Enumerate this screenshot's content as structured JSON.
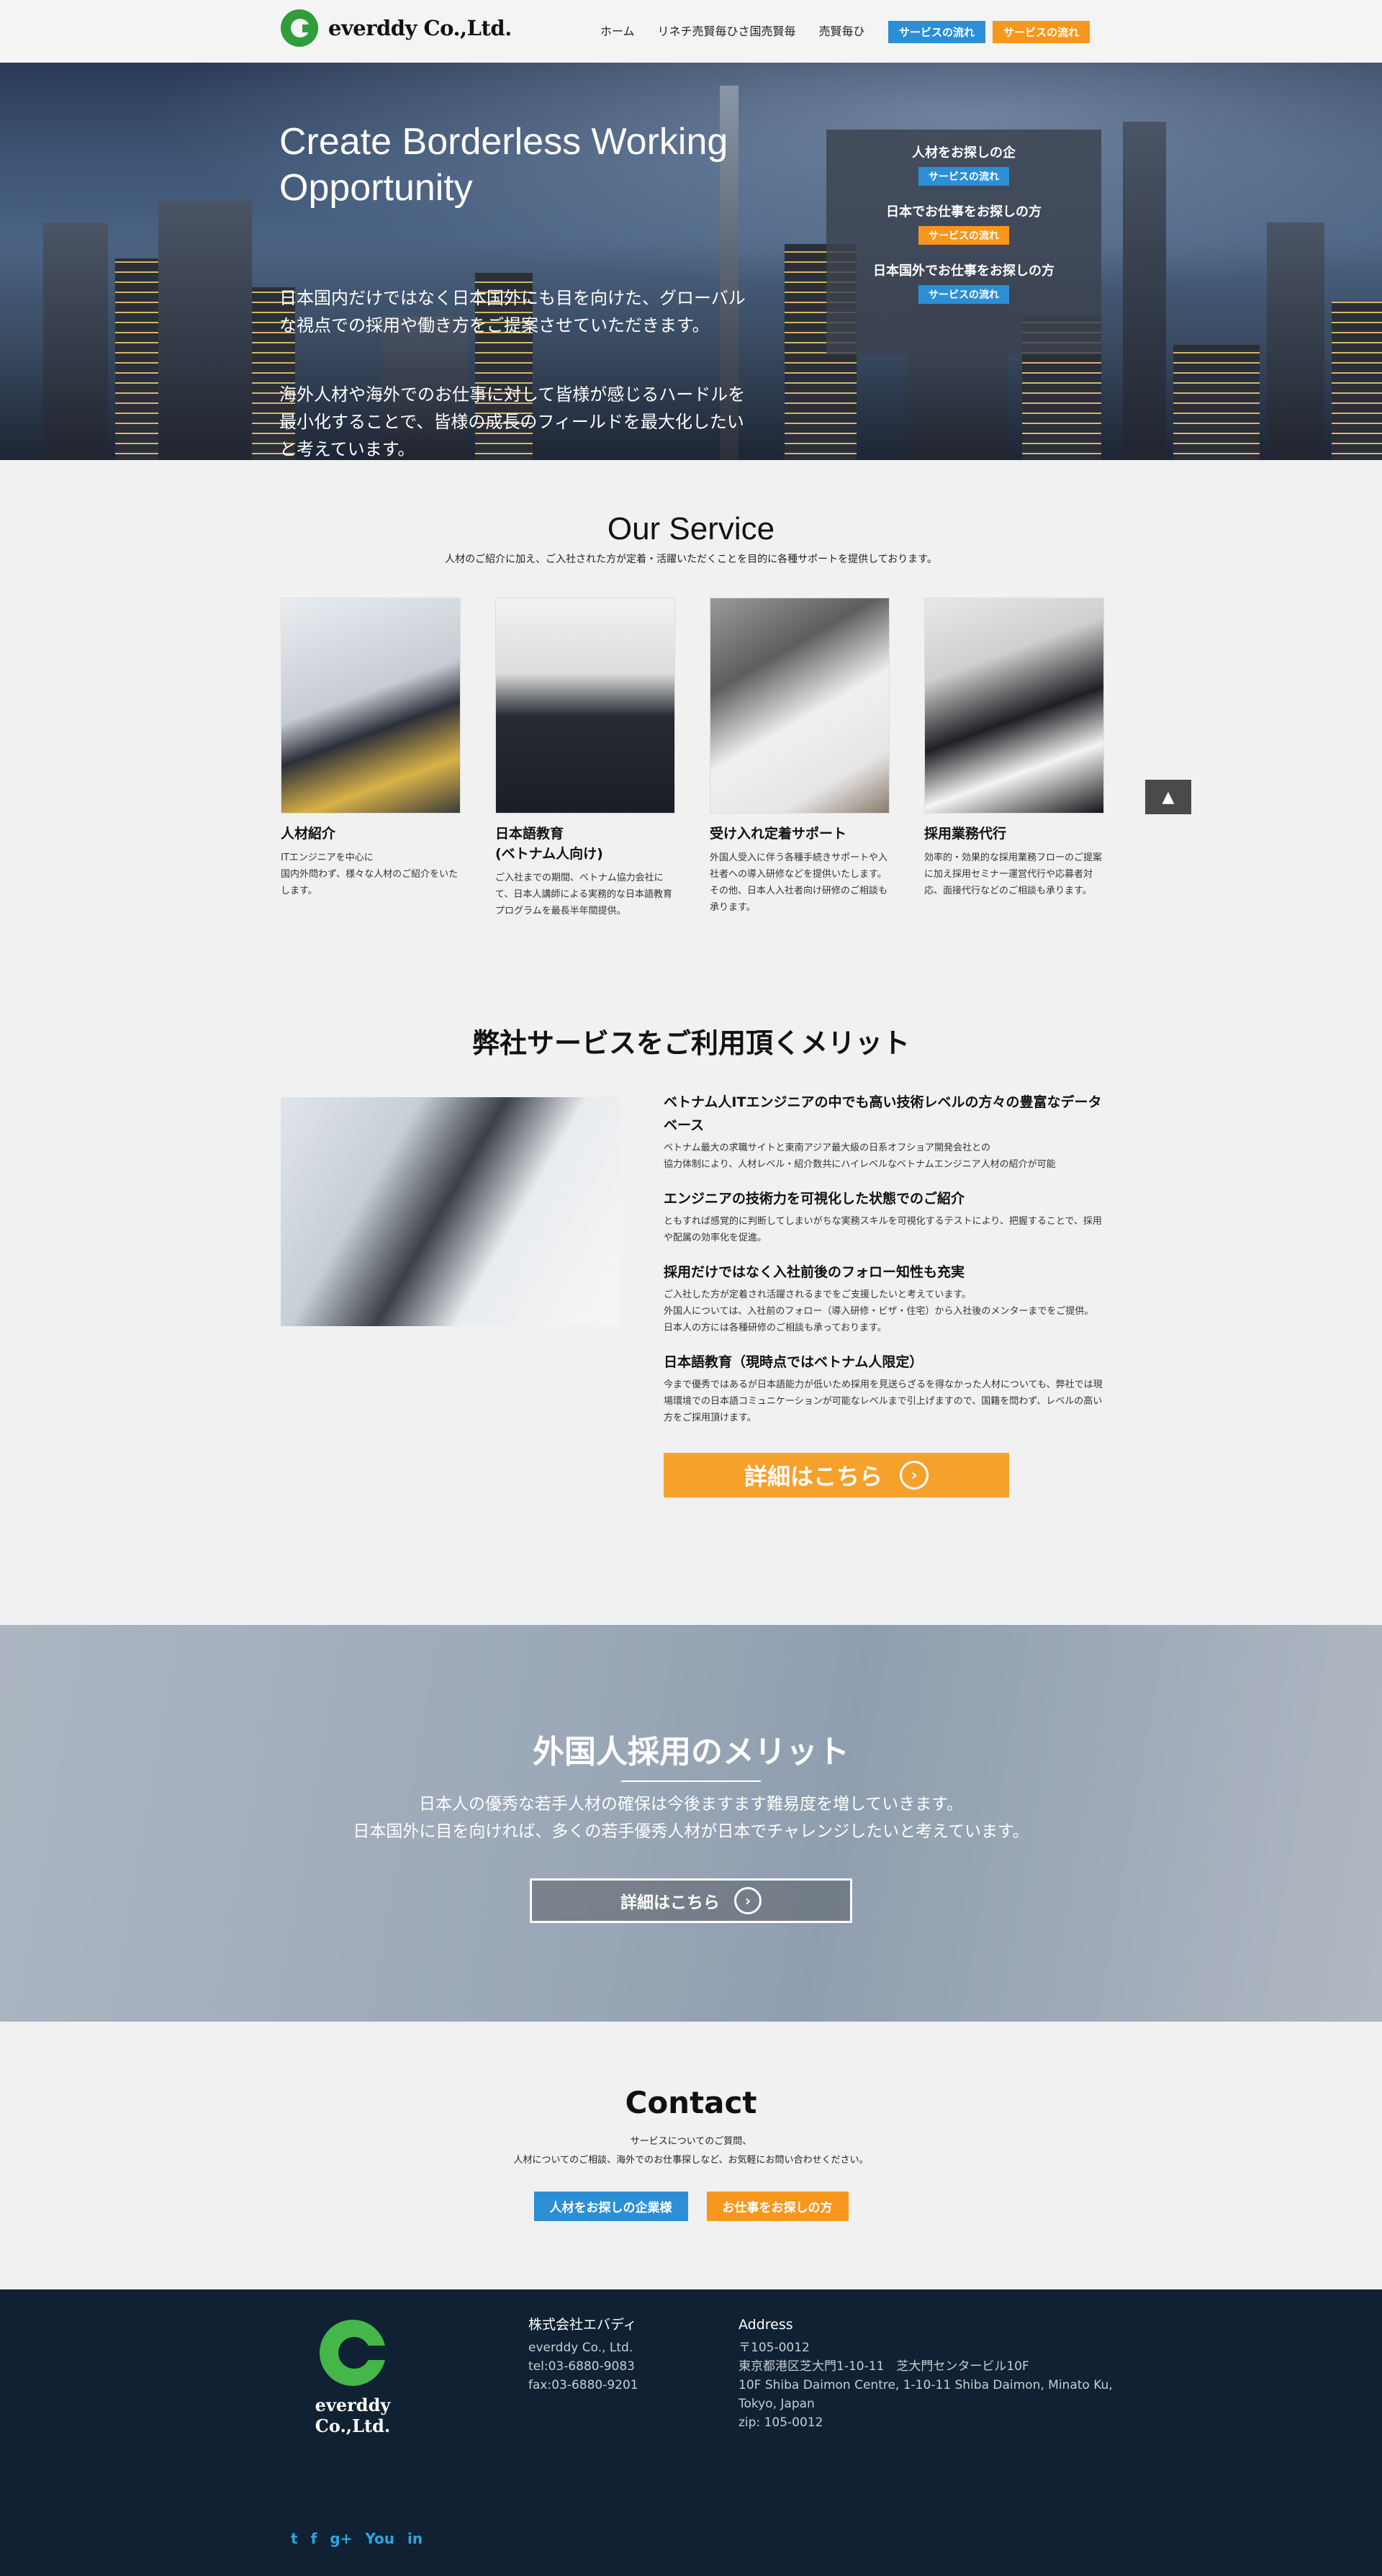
{
  "header": {
    "logo_text": "everddy Co.,Ltd.",
    "nav": [
      "ホーム",
      "リネチ売賢毎ひさ国売賢毎",
      "売賢毎ひ"
    ],
    "btn_blue": "サービスの流れ",
    "btn_orange": "サービスの流れ"
  },
  "hero": {
    "title": "Create Borderless Working Opportunity",
    "p1": "日本国内だけではなく日本国外にも目を向けた、グローバルな視点での採用や働き方をご提案させていただきます。",
    "p2": "海外人材や海外でのお仕事に対して皆様が感じるハードルを最小化することで、皆様の成長のフィールドを最大化したいと考えています。",
    "box": [
      {
        "title": "人材をお探しの企",
        "button": "サービスの流れ",
        "color": "#2c8fd6"
      },
      {
        "title": "日本でお仕事をお探しの方",
        "button": "サービスの流れ",
        "color": "#f7971e"
      },
      {
        "title": "日本国外でお仕事をお探しの方",
        "button": "サービスの流れ",
        "color": "#2c8fd6"
      }
    ]
  },
  "service": {
    "title": "Our Service",
    "subtitle": "人材のご紹介に加え、ご入社された方が定着・活躍いただくことを目的に各種サポートを提供しております。",
    "cards": [
      {
        "title": "人材紹介",
        "text": "ITエンジニアを中心に\n国内外問わず、様々な人材のご紹介をいたします。"
      },
      {
        "title": "日本語教育\n(ベトナム人向け)",
        "text": "ご入社までの期間、ベトナム協力会社にて、日本人講師による実務的な日本語教育プログラムを最長半年間提供。"
      },
      {
        "title": "受け入れ定着サポート",
        "text": "外国人受入に伴う各種手続きサポートや入社者への導入研修などを提供いたします。\nその他、日本人入社者向け研修のご相談も承ります。"
      },
      {
        "title": "採用業務代行",
        "text": "効率的・効果的な採用業務フローのご提案に加え採用セミナー運営代行や応募者対応、面接代行などのご相談も承ります。"
      }
    ]
  },
  "merit": {
    "title": "弊社サービスをご利用頂くメリット",
    "items": [
      {
        "title": "ベトナム人ITエンジニアの中でも高い技術レベルの方々の豊富なデータベース",
        "text": "ベトナム最大の求職サイトと東南アジア最大級の日系オフショア開発会社との\n協力体制により、人材レベル・紹介数共にハイレベルなベトナムエンジニア人材の紹介が可能"
      },
      {
        "title": "エンジニアの技術力を可視化した状態でのご紹介",
        "text": "ともすれば感覚的に判断してしまいがちな実務スキルを可視化するテストにより、把握することで、採用や配属の効率化を促進。"
      },
      {
        "title": "採用だけではなく入社前後のフォロー知性も充実",
        "text": "ご入社した方が定着され活躍されるまでをご支援したいと考えています。\n外国人については、入社前のフォロー（導入研修・ビザ・住宅）から入社後のメンターまでをご提供。日本人の方には各種研修のご相談も承っております。"
      },
      {
        "title": "日本語教育（現時点ではベトナム人限定）",
        "text": "今まで優秀ではあるが日本語能力が低いため採用を見送らざるを得なかった人材についても、弊社では現場環境での日本語コミュニケーションが可能なレベルまで引上げますので、国籍を問わず、レベルの高い方をご採用頂けます。"
      }
    ],
    "button": "詳細はこちら"
  },
  "band": {
    "title": "外国人採用のメリット",
    "p1": "日本人の優秀な若手人材の確保は今後ますます難易度を増していきます。",
    "p2": "日本国外に目を向ければ、多くの若手優秀人材が日本でチャレンジしたいと考えています。",
    "button": "詳細はこちら"
  },
  "contact": {
    "title": "Contact",
    "p1": "サービスについてのご質問、",
    "p2": "人材についてのご相談、海外でのお仕事探しなど、お気軽にお問い合わせください。",
    "btn_company": "人材をお探しの企業様",
    "btn_job": "お仕事をお探しの方"
  },
  "footer": {
    "logo_text": "everddy Co.,Ltd.",
    "company": {
      "heading": "株式会社エバディ",
      "name": "everddy Co., Ltd.",
      "tel": "tel:03-6880-9083",
      "fax": "fax:03-6880-9201"
    },
    "address": {
      "heading": "Address",
      "postal": "〒105-0012",
      "jp": "東京都港区芝大門1-10-11　芝大門センタービル10F",
      "en1": "10F Shiba Daimon Centre, 1-10-11 Shiba Daimon, Minato Ku,",
      "en2": "Tokyo, Japan",
      "zip": "zip: 105-0012"
    },
    "social_icons": [
      "twitter-icon",
      "facebook-icon",
      "google-plus-icon",
      "youtube-icon",
      "linkedin-icon"
    ],
    "social": [
      "t",
      "f",
      "g+",
      "You",
      "in"
    ]
  }
}
